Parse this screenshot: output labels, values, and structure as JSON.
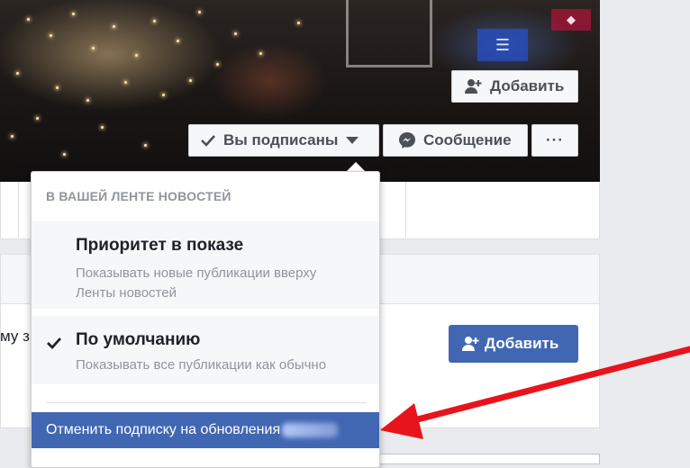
{
  "cover": {
    "add_friend_label": "Добавить",
    "following_label": "Вы подписаны",
    "message_label": "Сообщение",
    "more_label": "···"
  },
  "card": {
    "partial_text": "му з",
    "add_friend_label": "Добавить"
  },
  "dropdown": {
    "header": "В ВАШЕЙ ЛЕНТЕ НОВОСТЕЙ",
    "options": [
      {
        "title": "Приоритет в показе",
        "desc_line1": "Показывать новые публикации вверху",
        "desc_line2": "Ленты новостей",
        "checked": false
      },
      {
        "title": "По умолчанию",
        "desc_line1": "Показывать все публикации как обычно",
        "checked": true
      }
    ],
    "unfollow_label": "Отменить подписку на обновления"
  },
  "colors": {
    "facebook_blue": "#4267b2",
    "annotation_arrow": "#e8141c",
    "muted_text": "#90949c"
  },
  "icons": {
    "add_friend": "person-plus-icon",
    "following_check": "check-icon",
    "dropdown_caret": "caret-down-icon",
    "messenger": "messenger-icon",
    "option_selected": "check-icon"
  }
}
